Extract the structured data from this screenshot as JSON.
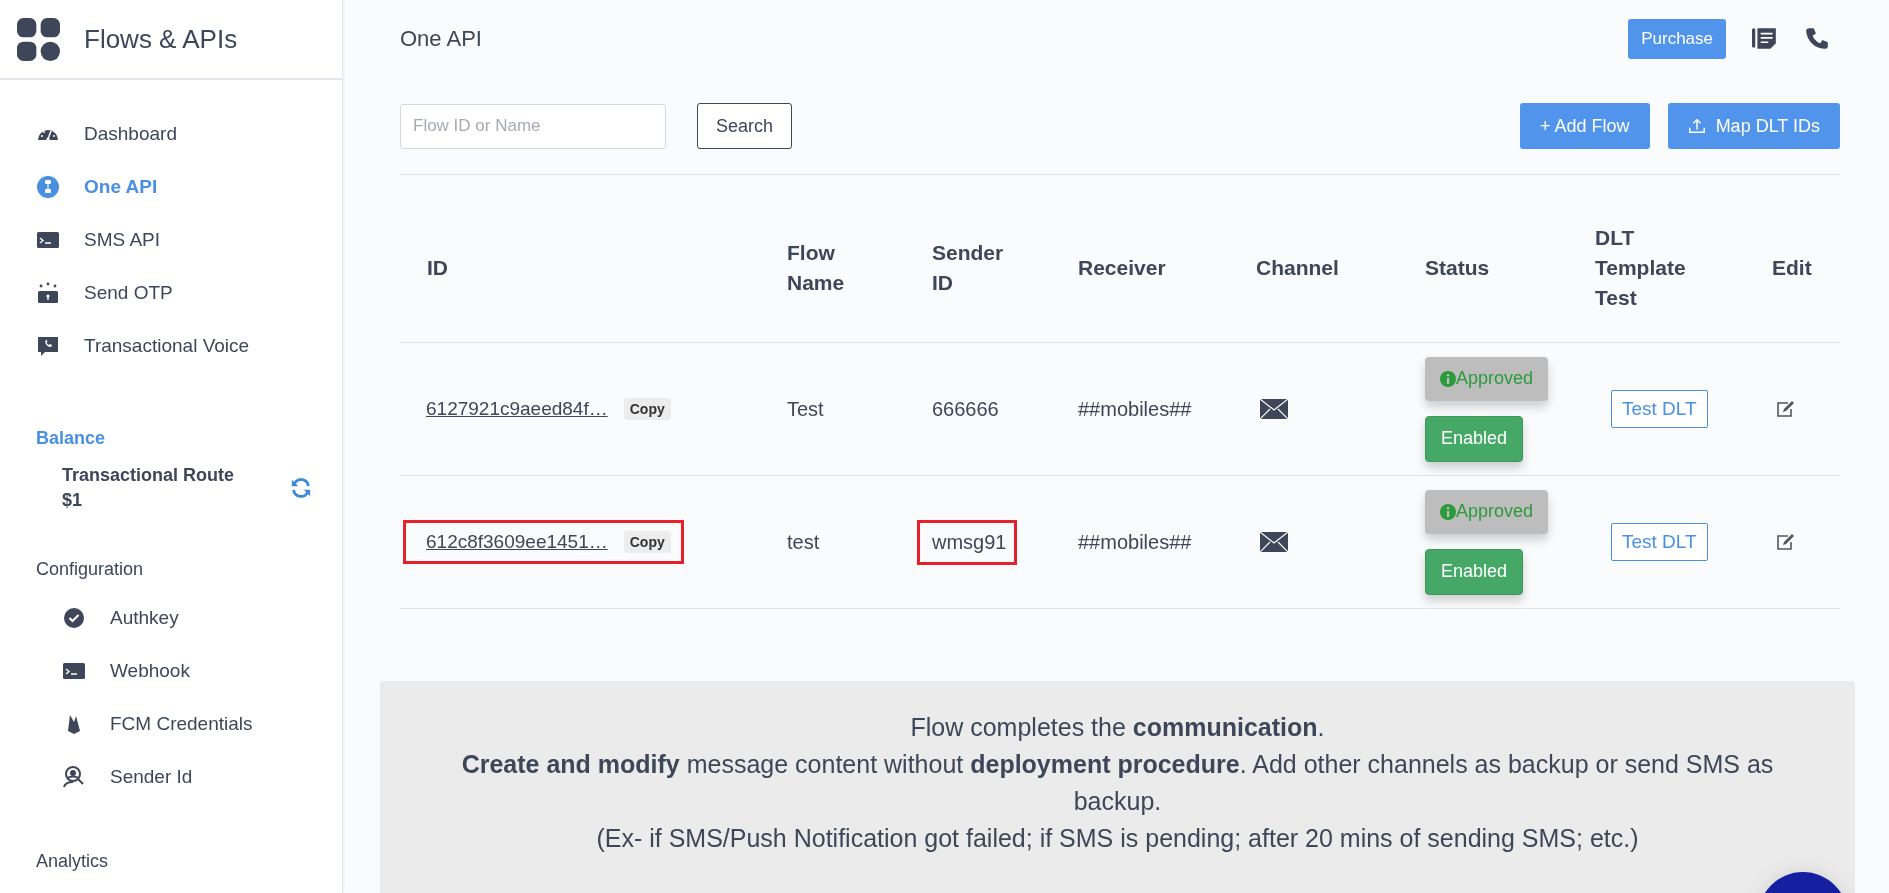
{
  "sidebar": {
    "title": "Flows & APIs",
    "nav_items": [
      {
        "label": "Dashboard",
        "selected": false
      },
      {
        "label": "One API",
        "selected": true
      },
      {
        "label": "SMS API",
        "selected": false
      },
      {
        "label": "Send OTP",
        "selected": false
      },
      {
        "label": "Transactional Voice",
        "selected": false
      }
    ],
    "balance": {
      "title": "Balance",
      "route": "Transactional Route",
      "amount": "$1"
    },
    "configuration": {
      "title": "Configuration",
      "items": [
        {
          "label": "Authkey",
          "selected": false
        },
        {
          "label": "Webhook",
          "selected": false
        },
        {
          "label": "FCM Credentials",
          "selected": false
        },
        {
          "label": "Sender Id",
          "selected": false
        }
      ]
    },
    "analytics": {
      "title": "Analytics"
    }
  },
  "header": {
    "title": "One API",
    "purchase_button": "Purchase"
  },
  "toolbar": {
    "search": {
      "placeholder": "Flow ID or Name"
    },
    "search_button": "Search",
    "add_button": "+ Add Flow",
    "map_button": "Map DLT IDs"
  },
  "table": {
    "columns": [
      "ID",
      "Flow Name",
      "Sender ID",
      "Receiver",
      "Channel",
      "Status",
      "DLT Template Test",
      "Edit"
    ],
    "rows": [
      {
        "id": "6127921c9aeed84f…",
        "copy": "Copy",
        "id_highlighted": false,
        "flow_name": "Test",
        "sender_id": "666666",
        "sender_highlighted": false,
        "receiver": "##mobiles##",
        "status_badges": [
          {
            "label": "Approved",
            "kind": "approval"
          },
          {
            "label": "Enabled",
            "kind": "enabled"
          }
        ],
        "test_button": "Test DLT"
      },
      {
        "id": "612c8f3609ee1451…",
        "copy": "Copy",
        "id_highlighted": true,
        "flow_name": "test",
        "sender_id": "wmsg91",
        "sender_highlighted": true,
        "receiver": "##mobiles##",
        "status_badges": [
          {
            "label": "Approved",
            "kind": "approval"
          },
          {
            "label": "Enabled",
            "kind": "enabled"
          }
        ],
        "test_button": "Test DLT"
      }
    ]
  },
  "info_banner": {
    "lines": [
      "Flow completes the **communication**.",
      "**Create and modify** message content without **deployment procedure**. Add other channels as backup or send SMS as backup.",
      "(Ex- if SMS/Push Notification got failed; if SMS is pending; after 20 mins of sending SMS; etc.)"
    ]
  }
}
